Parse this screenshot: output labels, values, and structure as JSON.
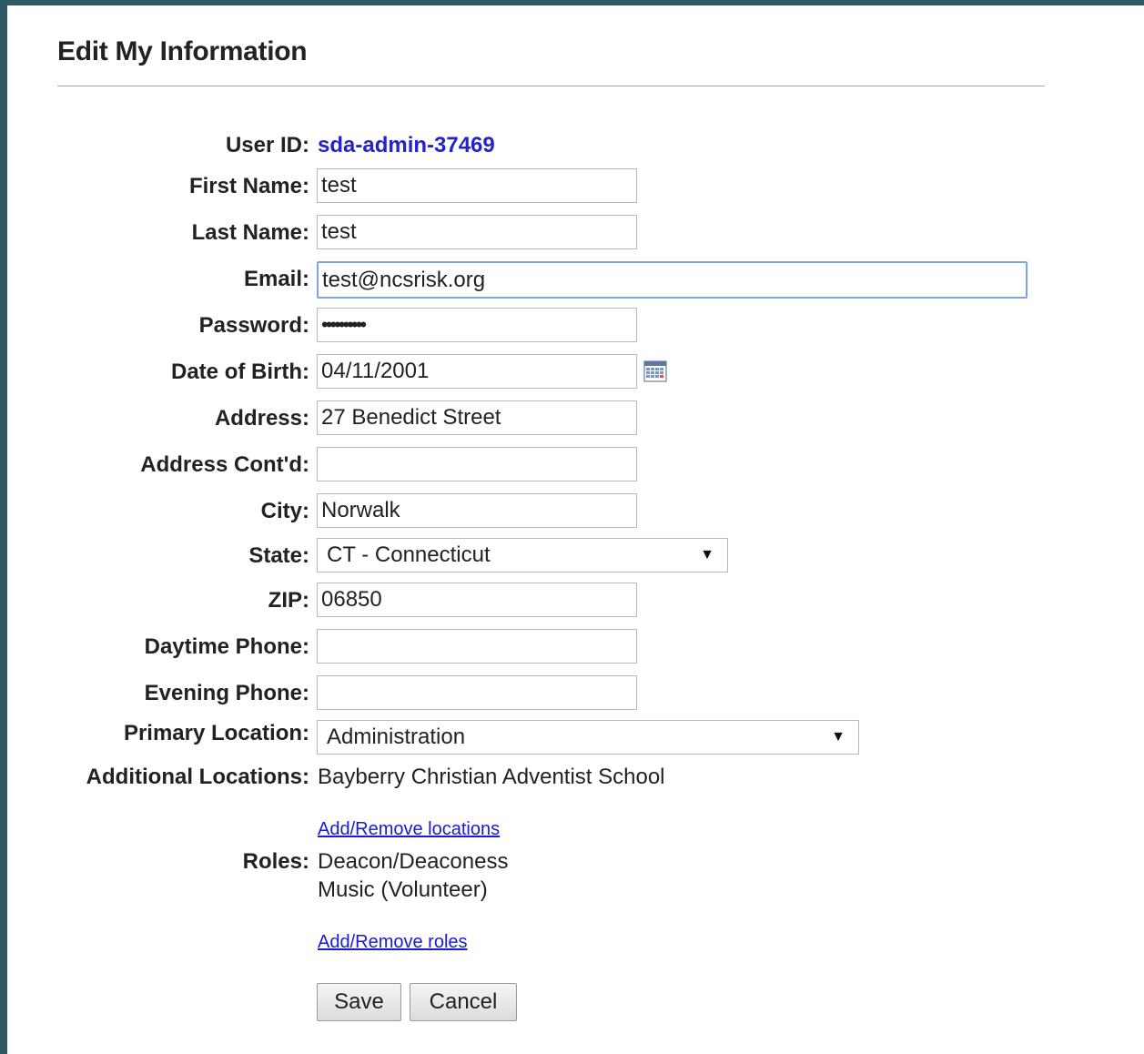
{
  "page": {
    "title": "Edit My Information"
  },
  "form": {
    "user_id_label": "User ID:",
    "user_id": "sda-admin-37469",
    "first_name_label": "First Name:",
    "first_name": "test",
    "last_name_label": "Last Name:",
    "last_name": "test",
    "email_label": "Email:",
    "email": "test@ncsrisk.org",
    "password_label": "Password:",
    "password": "••••••••••",
    "dob_label": "Date of Birth:",
    "dob": "04/11/2001",
    "address_label": "Address:",
    "address": "27 Benedict Street",
    "address2_label": "Address Cont'd:",
    "address2": "",
    "city_label": "City:",
    "city": "Norwalk",
    "state_label": "State:",
    "state": "CT - Connecticut",
    "zip_label": "ZIP:",
    "zip": "06850",
    "day_phone_label": "Daytime Phone:",
    "day_phone": "",
    "evening_phone_label": "Evening Phone:",
    "evening_phone": "",
    "primary_location_label": "Primary Location:",
    "primary_location": "Administration",
    "additional_locations_label": "Additional Locations:",
    "additional_locations": "Bayberry Christian Adventist School",
    "add_remove_locations": "Add/Remove locations",
    "roles_label": "Roles:",
    "roles": [
      "Deacon/Deaconess",
      "Music (Volunteer)"
    ],
    "add_remove_roles": "Add/Remove roles",
    "save_label": "Save",
    "cancel_label": "Cancel"
  },
  "icons": {
    "calendar": "calendar-icon",
    "dropdown": "chevron-down-icon"
  },
  "colors": {
    "frame": "#2e5a66",
    "user_id": "#2323c8",
    "link": "#1a1ad6",
    "focus_border": "#7ea6de"
  }
}
